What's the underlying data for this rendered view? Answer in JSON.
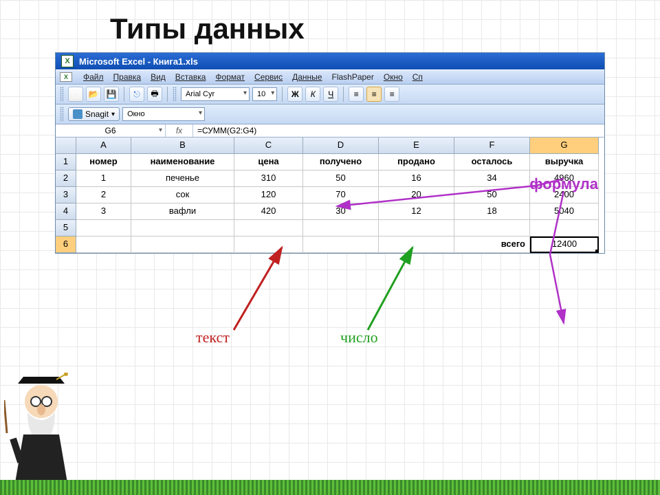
{
  "slide": {
    "title": "Типы  данных"
  },
  "titlebar": {
    "text": "Microsoft Excel - Книга1.xls"
  },
  "menu": {
    "items": [
      "Файл",
      "Правка",
      "Вид",
      "Вставка",
      "Формат",
      "Сервис",
      "Данные",
      "FlashPaper",
      "Окно",
      "Сп"
    ]
  },
  "toolbar": {
    "font_name": "Arial Cyr",
    "font_size": "10"
  },
  "snagit": {
    "label": "Snagit",
    "dropdown": "Окно"
  },
  "labels": {
    "formula": "формула",
    "text": "текст",
    "number": "число"
  },
  "formula_bar": {
    "cell_ref": "G6",
    "fx": "fx",
    "formula": "=СУММ(G2:G4)"
  },
  "columns": [
    "A",
    "B",
    "C",
    "D",
    "E",
    "F",
    "G"
  ],
  "header_row": [
    "номер",
    "наименование",
    "цена",
    "получено",
    "продано",
    "осталось",
    "выручка"
  ],
  "data_rows": [
    {
      "n": "1",
      "vals": [
        "1",
        "печенье",
        "310",
        "50",
        "16",
        "34",
        "4960"
      ]
    },
    {
      "n": "2",
      "vals": [
        "2",
        "сок",
        "120",
        "70",
        "20",
        "50",
        "2400"
      ]
    },
    {
      "n": "3",
      "vals": [
        "3",
        "вафли",
        "420",
        "30",
        "12",
        "18",
        "5040"
      ]
    }
  ],
  "row5": {
    "n": "5"
  },
  "total_row": {
    "n": "6",
    "label": "всего",
    "value": "12400"
  }
}
